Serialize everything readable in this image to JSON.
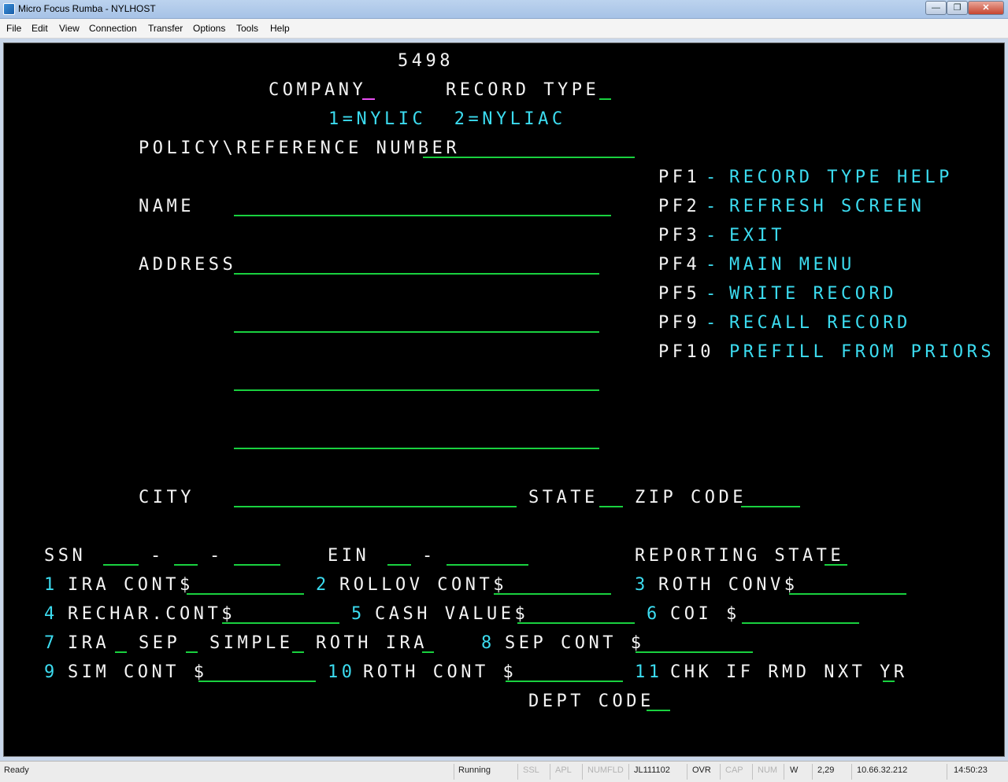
{
  "window": {
    "title": "Micro Focus Rumba - NYLHOST",
    "min": "—",
    "max": "❐",
    "close": "✕"
  },
  "menu": [
    "File",
    "Edit",
    "View",
    "Connection",
    "Transfer",
    "Options",
    "Tools",
    "Help"
  ],
  "screen": {
    "form_id": "5498",
    "company_label": "COMPANY",
    "record_type_label": "RECORD TYPE",
    "company_options": "1=NYLIC  2=NYLIAC",
    "policy_label": "POLICY\\REFERENCE NUMBER",
    "name_label": "NAME",
    "address_label": "ADDRESS",
    "city_label": "CITY",
    "state_label": "STATE",
    "zip_label": "ZIP CODE",
    "ssn_label": "SSN",
    "dash": "-",
    "ein_label": "EIN",
    "reporting_state_label": "REPORTING STATE",
    "pf_keys": [
      {
        "key": "PF1",
        "sep": "-",
        "desc": "RECORD TYPE HELP"
      },
      {
        "key": "PF2",
        "sep": "-",
        "desc": "REFRESH SCREEN"
      },
      {
        "key": "PF3",
        "sep": "-",
        "desc": "EXIT"
      },
      {
        "key": "PF4",
        "sep": "-",
        "desc": "MAIN MENU"
      },
      {
        "key": "PF5",
        "sep": "-",
        "desc": "WRITE RECORD"
      },
      {
        "key": "PF9",
        "sep": "-",
        "desc": "RECALL RECORD"
      },
      {
        "key": "PF10",
        "sep": "",
        "desc": "PREFILL FROM PRIORS"
      }
    ],
    "boxes": {
      "b1_num": "1",
      "b1_label": "IRA CONT$",
      "b2_num": "2",
      "b2_label": "ROLLOV CONT$",
      "b3_num": "3",
      "b3_label": "ROTH CONV$",
      "b4_num": "4",
      "b4_label": "RECHAR.CONT$",
      "b5_num": "5",
      "b5_label": "CASH VALUE$",
      "b6_num": "6",
      "b6_label": "COI $",
      "b7_num": "7",
      "b7_ira": "IRA",
      "b7_sep": "SEP",
      "b7_simple": "SIMPLE",
      "b7_roth": "ROTH IRA",
      "b8_num": "8",
      "b8_label": "SEP CONT $",
      "b9_num": "9",
      "b9_label": "SIM CONT $",
      "b10_num": "10",
      "b10_label": "ROTH CONT $",
      "b11_num": "11",
      "b11_label": "CHK IF RMD NXT YR"
    },
    "dept_label": "DEPT CODE"
  },
  "status": {
    "ready": "Ready",
    "running": "Running",
    "ssl": "SSL",
    "apl": "APL",
    "numfld": "NUMFLD",
    "session": "JL111102",
    "ovr": "OVR",
    "cap": "CAP",
    "num": "NUM",
    "w": "W",
    "cursor_pos": "2,29",
    "ip": "10.66.32.212",
    "time": "14:50:23"
  },
  "colors": {
    "terminal_bg": "#000000",
    "field_underline": "#19d13f",
    "label": "#f4f4f4",
    "accent": "#3cdcf0",
    "cursor": "#e84ff2"
  }
}
